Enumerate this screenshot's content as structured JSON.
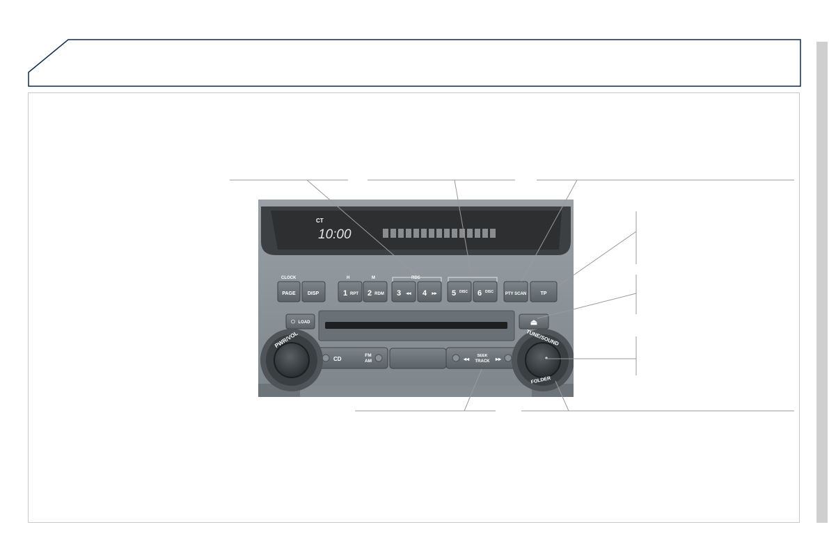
{
  "display": {
    "station_code": "CT",
    "clock": "10:00"
  },
  "top_labels": {
    "clock": "CLOCK",
    "hour": "H",
    "minute": "M",
    "rds": "RDS"
  },
  "buttons": {
    "page": "PAGE",
    "disp": "DISP",
    "preset1_num": "1",
    "preset1_sub": "RPT",
    "preset2_num": "2",
    "preset2_sub": "RDM",
    "preset3_num": "3",
    "preset3_sub": "◂◂",
    "preset4_num": "4",
    "preset4_sub": "▸▸",
    "preset5_num": "5",
    "preset5_sub": "DISC",
    "preset6_num": "6",
    "preset6_sub": "DISC",
    "pty_scan": "PTY SCAN",
    "tp": "TP",
    "load": "LOAD",
    "eject": "⏏",
    "cd": "CD",
    "fm": "FM",
    "am": "AM",
    "seek_prev": "◂◂",
    "seek": "SEEK",
    "track": "TRACK",
    "seek_next": "▸▸"
  },
  "knobs": {
    "left_label": "PWR/VOL",
    "right_label": "TUNE/SOUND",
    "right_bottom": "FOLDER"
  },
  "colors": {
    "faceplate": "#8d959b",
    "display_bg": "#2d2f30",
    "button": "#6c7479",
    "frame": "#c8c8c8",
    "tab_border": "#0f2a4a"
  }
}
